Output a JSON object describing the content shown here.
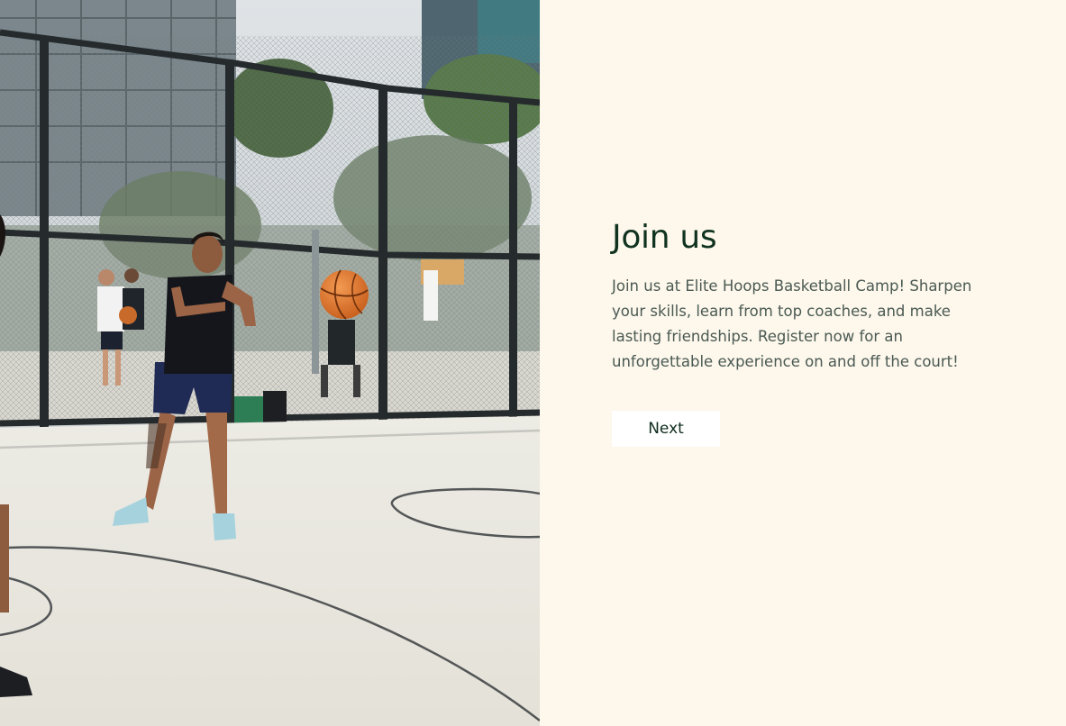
{
  "hero": {
    "image_alt": "Basketball player passing a ball on an outdoor court"
  },
  "content": {
    "title": "Join us",
    "description": "Join us at Elite Hoops Basketball Camp! Sharpen your skills, learn from top coaches, and make lasting friendships. Register now for an unforgettable experience on and off the court!",
    "next_label": "Next"
  },
  "colors": {
    "panel_background": "#fdf7ec",
    "title": "#10331f",
    "body_text": "#4a5a52",
    "button_background": "#ffffff",
    "button_text": "#0f2d1d",
    "ball": "#e07a2e"
  }
}
